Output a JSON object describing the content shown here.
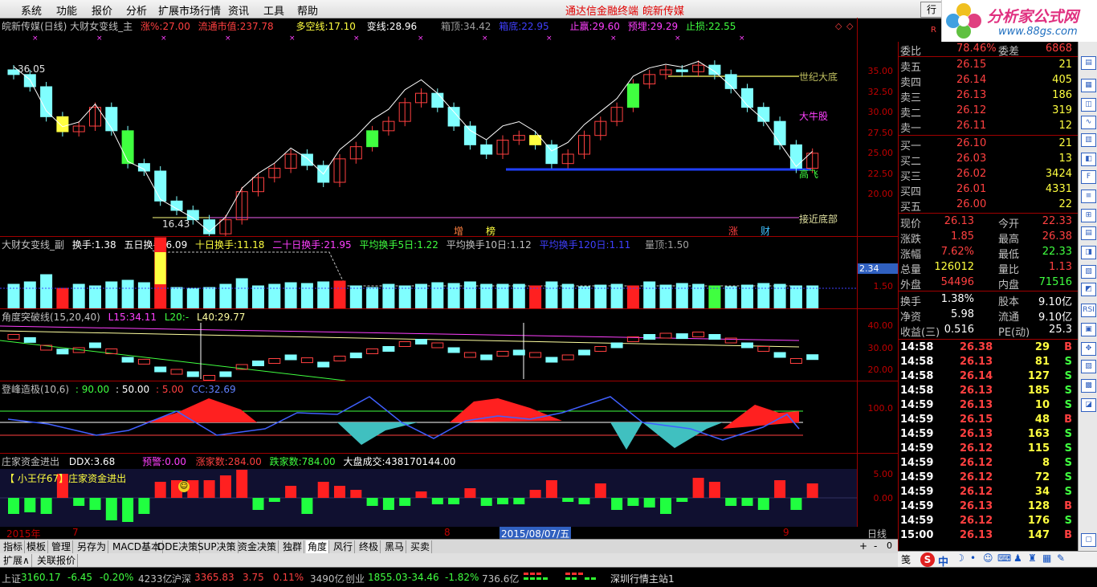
{
  "menu": {
    "items": [
      "系统",
      "功能",
      "报价",
      "分析",
      "扩展市场行情",
      "资讯",
      "工具",
      "帮助"
    ],
    "terminal": "通达信金融终端",
    "stock": "皖新传媒",
    "trade": "行"
  },
  "logo": {
    "text": "分析家公式网",
    "url": "www.88gs.com"
  },
  "main": {
    "title": "皖新传媒(日线) 大财女变线_主",
    "zhang_label": "涨%:",
    "zhang_val": "27.00",
    "ltsz_label": "流通市值:",
    "ltsz_val": "237.78",
    "dkx_label": "多空线:",
    "dkx_val": "17.10",
    "bx_label": "变线:",
    "bx_val": "28.96",
    "xd_label": "箱顶:",
    "xd_val": "34.42",
    "xdi_label": "箱底:",
    "xdi_val": "22.95",
    "zy_label": "止赢:",
    "zy_val": "29.60",
    "yz_label": "预埋:",
    "yz_val": "29.29",
    "zs_label": "止损:",
    "zs_val": "22.55",
    "high_mark": "36.05",
    "low_mark": "16.43",
    "label_sjdd": "世纪大底",
    "label_dnq": "大牛股",
    "label_gf": "高飞",
    "label_jjdb": "接近底部",
    "marks": [
      "增",
      "榜",
      "涨",
      "财"
    ],
    "yaxis": [
      "35.00",
      "32.50",
      "30.00",
      "27.50",
      "25.00",
      "22.50",
      "20.00"
    ]
  },
  "vol": {
    "title": "大财女变线_副",
    "hs_label": "换手:",
    "hs": "1.38",
    "wr_label": "五日换手:",
    "wr": "6.09",
    "sr_label": "十日换手:",
    "sr": "11.18",
    "esr_label": "二十日换手:",
    "esr": "21.95",
    "pj5_label": "平均换手5日:",
    "pj5": "1.22",
    "pj10_label": "平均换手10日:",
    "pj10": "1.12",
    "pj120_label": "平均换手120日:",
    "pj120": "1.11",
    "ld_label": "量顶:",
    "ld": "1.50",
    "yaxis": [
      "2.34",
      "1.50"
    ]
  },
  "angle": {
    "title": "角度突破线(15,20,40)",
    "l15_label": "L15:",
    "l15": "34.11",
    "l20_label": "L20:",
    "l20": "-",
    "l40_label": "L40:",
    "l40": "29.77",
    "yaxis": [
      "40.00",
      "30.00",
      "20.00"
    ]
  },
  "dfzj": {
    "title": "登峰造极(10,6)",
    "a": "90.00",
    "b": "50.00",
    "c": "5.00",
    "cc_label": "CC:",
    "cc": "32.69",
    "yaxis": [
      "100.0"
    ]
  },
  "zjjc": {
    "title": "庄家资金进出",
    "ddx_label": "DDX:",
    "ddx": "3.68",
    "yj_label": "预警:",
    "yj": "0.00",
    "zjs_label": "涨家数:",
    "zjs": "284.00",
    "djs_label": "跌家数:",
    "djs": "784.00",
    "dpcj_label": "大盘成交:",
    "dpcj": "438170144.00",
    "banner": "【 小王仔67】庄家资金进出",
    "yaxis": [
      "5.00",
      "0.00"
    ]
  },
  "timeaxis": {
    "year": "2015年",
    "m7": "7",
    "m8": "8",
    "cur": "2015/08/07/五",
    "m9": "9",
    "period": "日线"
  },
  "tabs": [
    "指标",
    "模板",
    "管理",
    "另存为",
    "MACD基本",
    "DDE决策",
    "SUP决策",
    "资金决策",
    "独群",
    "角度",
    "风行",
    "终极",
    "黑马",
    "买卖"
  ],
  "tabs2": [
    "扩展∧",
    "关联报价"
  ],
  "quote": {
    "wb_label": "委比",
    "wb": "78.46%",
    "wc_label": "委差",
    "wc": "6868",
    "asks": [
      {
        "l": "卖五",
        "p": "26.15",
        "v": "21"
      },
      {
        "l": "卖四",
        "p": "26.14",
        "v": "405"
      },
      {
        "l": "卖三",
        "p": "26.13",
        "v": "186"
      },
      {
        "l": "卖二",
        "p": "26.12",
        "v": "319"
      },
      {
        "l": "卖一",
        "p": "26.11",
        "v": "12"
      }
    ],
    "bids": [
      {
        "l": "买一",
        "p": "26.10",
        "v": "21"
      },
      {
        "l": "买二",
        "p": "26.03",
        "v": "13"
      },
      {
        "l": "买三",
        "p": "26.02",
        "v": "3424"
      },
      {
        "l": "买四",
        "p": "26.01",
        "v": "4331"
      },
      {
        "l": "买五",
        "p": "26.00",
        "v": "22"
      }
    ],
    "stats": [
      {
        "a": "现价",
        "av": "26.13",
        "b": "今开",
        "bv": "22.33"
      },
      {
        "a": "涨跌",
        "av": "1.85",
        "b": "最高",
        "bv": "26.38"
      },
      {
        "a": "涨幅",
        "av": "7.62%",
        "b": "最低",
        "bv": "22.33"
      },
      {
        "a": "总量",
        "av": "126012",
        "b": "量比",
        "bv": "1.13"
      },
      {
        "a": "外盘",
        "av": "54496",
        "b": "内盘",
        "bv": "71516"
      }
    ],
    "stats2": [
      {
        "a": "换手",
        "av": "1.38%",
        "b": "股本",
        "bv": "9.10亿"
      },
      {
        "a": "净资",
        "av": "5.98",
        "b": "流通",
        "bv": "9.10亿"
      },
      {
        "a": "收益(三)",
        "av": "0.516",
        "b": "PE(动)",
        "bv": "25.3"
      }
    ],
    "ticks": [
      {
        "t": "14:58",
        "p": "26.38",
        "v": "29",
        "d": "B"
      },
      {
        "t": "14:58",
        "p": "26.13",
        "v": "81",
        "d": "S"
      },
      {
        "t": "14:58",
        "p": "26.14",
        "v": "127",
        "d": "S"
      },
      {
        "t": "14:58",
        "p": "26.13",
        "v": "185",
        "d": "S"
      },
      {
        "t": "14:59",
        "p": "26.13",
        "v": "10",
        "d": "S"
      },
      {
        "t": "14:59",
        "p": "26.15",
        "v": "48",
        "d": "B"
      },
      {
        "t": "14:59",
        "p": "26.13",
        "v": "163",
        "d": "S"
      },
      {
        "t": "14:59",
        "p": "26.12",
        "v": "115",
        "d": "S"
      },
      {
        "t": "14:59",
        "p": "26.12",
        "v": "8",
        "d": "S"
      },
      {
        "t": "14:59",
        "p": "26.12",
        "v": "72",
        "d": "S"
      },
      {
        "t": "14:59",
        "p": "26.12",
        "v": "34",
        "d": "S"
      },
      {
        "t": "14:59",
        "p": "26.13",
        "v": "128",
        "d": "B"
      },
      {
        "t": "14:59",
        "p": "26.12",
        "v": "176",
        "d": "S"
      },
      {
        "t": "15:00",
        "p": "26.13",
        "v": "147",
        "d": "B"
      }
    ],
    "r_mark": "R",
    "ti_mark": "笺"
  },
  "status": {
    "sh_label": "上证",
    "sh": "3160.17",
    "sh_chg": "-6.45",
    "sh_pct": "-0.20%",
    "sh_amt": "4233亿",
    "hs_label": "沪深",
    "hs": "3365.83",
    "hs_chg": "3.75",
    "hs_pct": "0.11%",
    "hs_amt": "3490亿",
    "cy_label": "创业",
    "cy": "1855.03",
    "cy_chg": "-34.46",
    "cy_pct": "-1.82%",
    "cy_amt": "736.6亿",
    "server": "深圳行情主站1"
  },
  "ime": {
    "label": "中"
  }
}
